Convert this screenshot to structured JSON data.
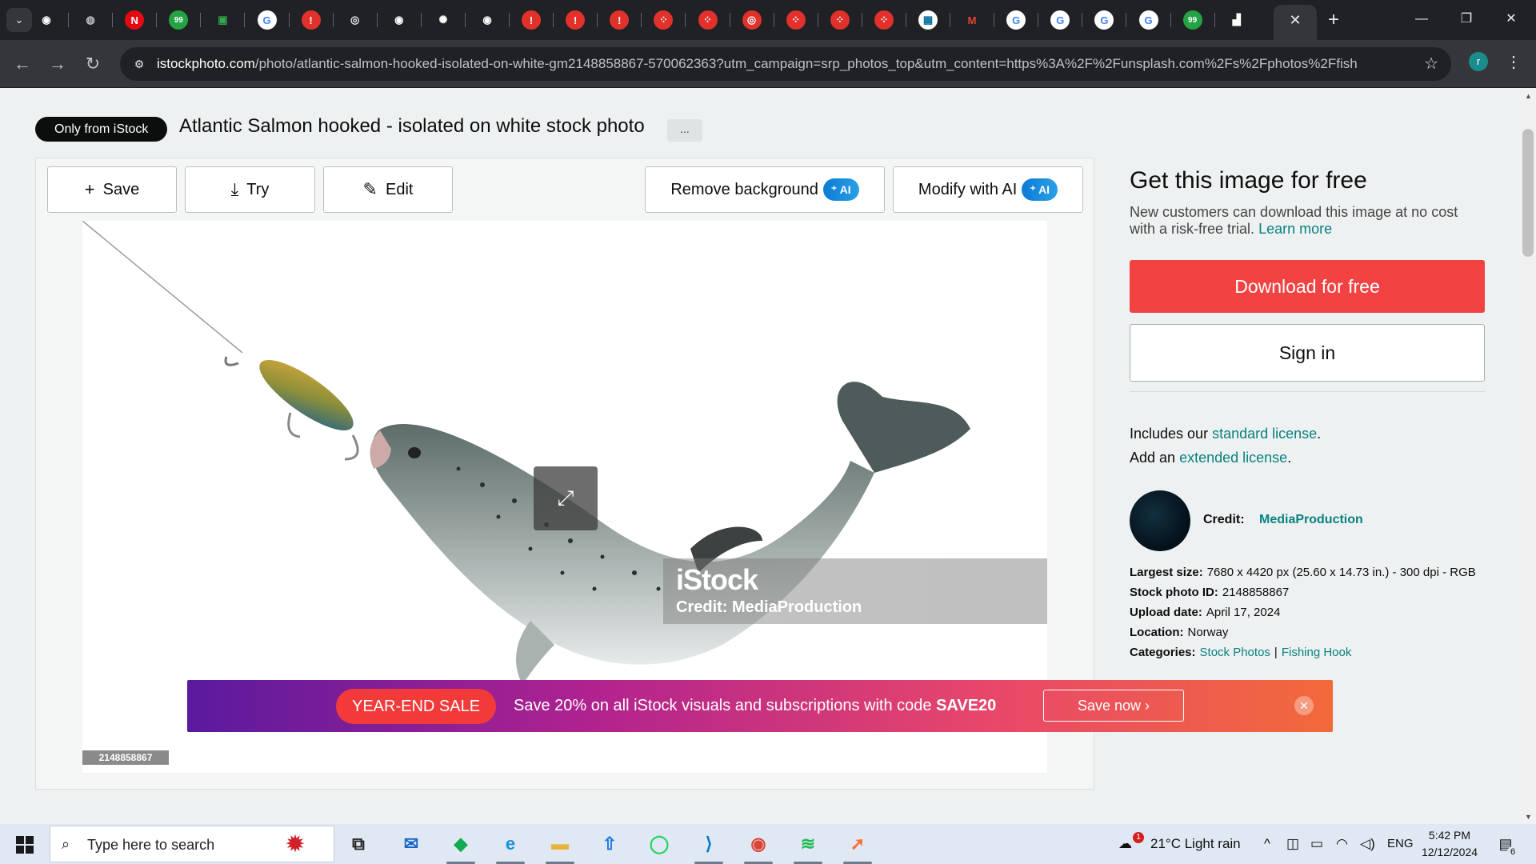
{
  "browser": {
    "tab_icons": [
      {
        "icon": "github-icon",
        "glyph": "◉",
        "bg": "#202124",
        "fg": "#ffffff"
      },
      {
        "icon": "chrome-settings-icon",
        "glyph": "◍",
        "bg": "#202124",
        "fg": "#bdc1c6"
      },
      {
        "icon": "netflix-icon",
        "glyph": "N",
        "bg": "#e50914",
        "fg": "#ffffff"
      },
      {
        "icon": "chat-99-icon",
        "glyph": "99",
        "bg": "#25a244",
        "fg": "#ffffff"
      },
      {
        "icon": "google-meet-icon",
        "glyph": "▣",
        "bg": "#202124",
        "fg": "#34a853"
      },
      {
        "icon": "google-icon",
        "glyph": "G",
        "bg": "#ffffff",
        "fg": "#4285f4"
      },
      {
        "icon": "alert-icon",
        "glyph": "!",
        "bg": "#e0312a",
        "fg": "#ffffff"
      },
      {
        "icon": "chrome-icon",
        "glyph": "◎",
        "bg": "#202124",
        "fg": "#e8eaed"
      },
      {
        "icon": "github-icon",
        "glyph": "◉",
        "bg": "#202124",
        "fg": "#ffffff"
      },
      {
        "icon": "chatgpt-icon",
        "glyph": "✺",
        "bg": "#202124",
        "fg": "#ffffff"
      },
      {
        "icon": "github-icon",
        "glyph": "◉",
        "bg": "#202124",
        "fg": "#ffffff"
      },
      {
        "icon": "alert-icon",
        "glyph": "!",
        "bg": "#e0312a",
        "fg": "#ffffff"
      },
      {
        "icon": "alert-icon",
        "glyph": "!",
        "bg": "#e0312a",
        "fg": "#ffffff"
      },
      {
        "icon": "alert-icon",
        "glyph": "!",
        "bg": "#e0312a",
        "fg": "#ffffff"
      },
      {
        "icon": "dots-grid-icon",
        "glyph": "⁘",
        "bg": "#e0312a",
        "fg": "#ffffff"
      },
      {
        "icon": "dots-grid-icon",
        "glyph": "⁘",
        "bg": "#e0312a",
        "fg": "#ffffff"
      },
      {
        "icon": "target-icon",
        "glyph": "◎",
        "bg": "#e0312a",
        "fg": "#ffffff"
      },
      {
        "icon": "dots-grid-icon",
        "glyph": "⁘",
        "bg": "#e0312a",
        "fg": "#ffffff"
      },
      {
        "icon": "dots-grid-icon",
        "glyph": "⁘",
        "bg": "#e0312a",
        "fg": "#ffffff"
      },
      {
        "icon": "dots-grid-icon",
        "glyph": "⁘",
        "bg": "#e0312a",
        "fg": "#ffffff"
      },
      {
        "icon": "image-icon",
        "glyph": "▦",
        "bg": "#ffffff",
        "fg": "#0a6e9e"
      },
      {
        "icon": "gmail-icon",
        "glyph": "M",
        "bg": "#202124",
        "fg": "#ea4335"
      },
      {
        "icon": "google-icon",
        "glyph": "G",
        "bg": "#ffffff",
        "fg": "#4285f4"
      },
      {
        "icon": "google-icon",
        "glyph": "G",
        "bg": "#ffffff",
        "fg": "#4285f4"
      },
      {
        "icon": "google-icon",
        "glyph": "G",
        "bg": "#ffffff",
        "fg": "#4285f4"
      },
      {
        "icon": "google-icon",
        "glyph": "G",
        "bg": "#ffffff",
        "fg": "#4285f4"
      },
      {
        "icon": "chat-99-icon",
        "glyph": "99",
        "bg": "#25a244",
        "fg": "#ffffff"
      },
      {
        "icon": "istock-icon",
        "glyph": "▟",
        "bg": "#202124",
        "fg": "#ffffff"
      }
    ],
    "url_host": "istockphoto.com",
    "url_rest": "/photo/atlantic-salmon-hooked-isolated-on-white-gm2148858867-570062363?utm_campaign=srp_photos_top&utm_content=https%3A%2F%2Funsplash.com%2Fs%2Fphotos%2Ffishi...",
    "profile_initial": "r"
  },
  "page": {
    "badge": "Only from iStock",
    "title": "Atlantic Salmon hooked - isolated on white stock photo",
    "more_label": "...",
    "actions": {
      "save": "Save",
      "try": "Try",
      "edit": "Edit",
      "remove_bg": "Remove background",
      "modify_ai": "Modify with AI",
      "ai_badge": "⁺ AI"
    },
    "image": {
      "watermark_brand": "iStock",
      "watermark_credit": "Credit: MediaProduction",
      "image_id": "2148858867"
    }
  },
  "panel": {
    "heading": "Get this image for free",
    "lead": "New customers can download this image at no cost with a risk-free trial.",
    "learn_more": "Learn more",
    "download": "Download for free",
    "sign_in": "Sign in",
    "license_prefix": "Includes our",
    "license_link": "standard license",
    "extended_prefix": "Add an",
    "extended_link": "extended license",
    "credit_label": "Credit:",
    "credit_name": "MediaProduction",
    "details": {
      "largest_size_label": "Largest size:",
      "largest_size_value": "7680 x 4420 px (25.60 x 14.73 in.) - 300 dpi - RGB",
      "stock_id_label": "Stock photo ID:",
      "stock_id_value": "2148858867",
      "upload_label": "Upload date:",
      "upload_value": "April 17, 2024",
      "location_label": "Location:",
      "location_value": "Norway",
      "categories_label": "Categories:",
      "category_1": "Stock Photos",
      "category_sep": "|",
      "category_2": "Fishing Hook"
    }
  },
  "promo": {
    "badge": "YEAR-END SALE",
    "text": "Save 20% on all iStock visuals and subscriptions with code",
    "code": "SAVE20",
    "cta": "Save now ›",
    "close": "✕"
  },
  "taskbar": {
    "search_placeholder": "Type here to search",
    "weather": "21°C  Light rain",
    "weather_alert": "1",
    "language": "ENG",
    "time": "5:42 PM",
    "date": "12/12/2024",
    "notifications": "6",
    "apps": [
      {
        "icon": "task-view-icon",
        "glyph": "⧉",
        "color": "#222222"
      },
      {
        "icon": "mail-icon",
        "glyph": "✉",
        "color": "#1467c4"
      },
      {
        "icon": "mongodb-icon",
        "glyph": "◆",
        "color": "#13aa52"
      },
      {
        "icon": "edge-icon",
        "glyph": "e",
        "color": "#1b8fd8"
      },
      {
        "icon": "file-explorer-icon",
        "glyph": "▬",
        "color": "#e8b33a"
      },
      {
        "icon": "upload-app-icon",
        "glyph": "⇧",
        "color": "#1a73e8"
      },
      {
        "icon": "whatsapp-icon",
        "glyph": "◯",
        "color": "#25d366"
      },
      {
        "icon": "vscode-icon",
        "glyph": "⟩",
        "color": "#007acc"
      },
      {
        "icon": "chrome-icon",
        "glyph": "◉",
        "color": "#db4437"
      },
      {
        "icon": "spotify-icon",
        "glyph": "≋",
        "color": "#1db954"
      },
      {
        "icon": "postman-icon",
        "glyph": "➚",
        "color": "#ff6c37"
      }
    ]
  },
  "colors": {
    "brand_teal": "#0a8080",
    "download_red": "#f24242",
    "dark": "#0c0d0d"
  }
}
